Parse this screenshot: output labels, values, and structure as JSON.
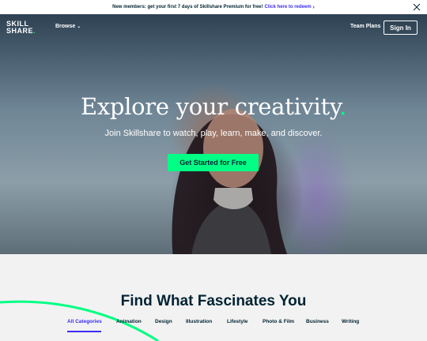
{
  "promo": {
    "text": "New members: get your first 7 days of Skillshare Premium for free!",
    "link": "Click here to redeem"
  },
  "nav": {
    "logo_line1": "SKILL",
    "logo_line2": "SHARE",
    "logo_dot": ".",
    "browse": "Browse",
    "team_plans": "Team Plans",
    "sign_in": "Sign In"
  },
  "hero": {
    "title": "Explore your creativity",
    "title_dot": ".",
    "subtitle": "Join Skillshare to watch, play, learn, make, and discover.",
    "cta": "Get Started for Free"
  },
  "categories": {
    "title": "Find What Fascinates You",
    "tabs": [
      "All Categories",
      "Animation",
      "Design",
      "Illustration",
      "Lifestyle",
      "Photo & Film",
      "Business",
      "Writing"
    ],
    "active_tab": "All Categories"
  },
  "colors": {
    "brand_green": "#00ff84",
    "link_blue": "#3a2cf5",
    "text_dark": "#002333"
  }
}
